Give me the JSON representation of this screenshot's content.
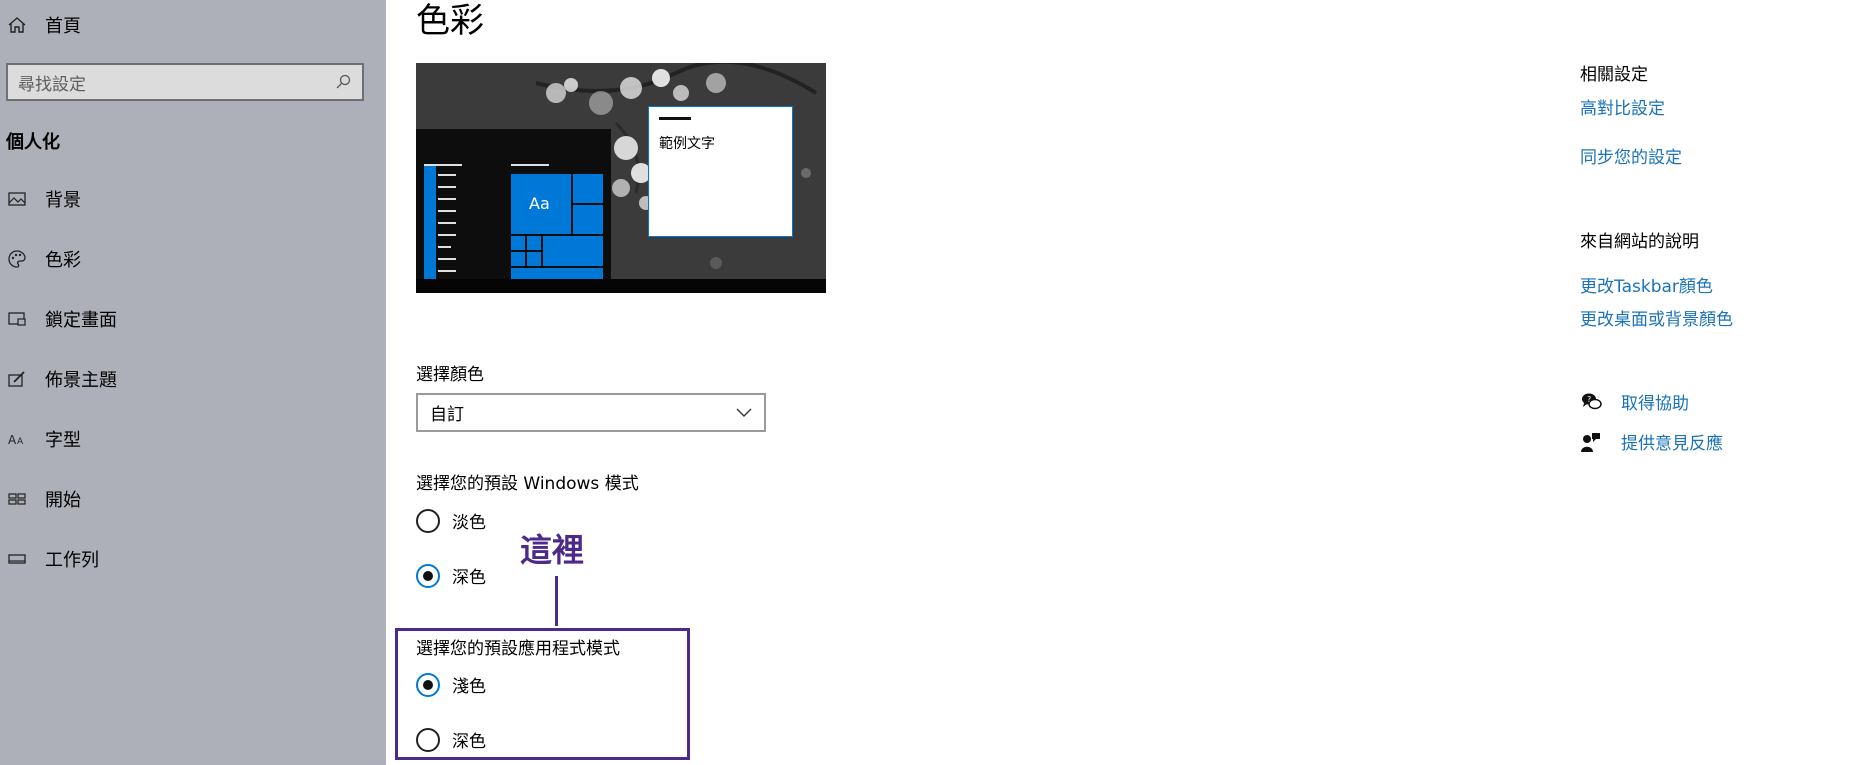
{
  "sidebar": {
    "home_label": "首頁",
    "search_placeholder": "尋找設定",
    "section_title": "個人化",
    "items": [
      {
        "label": "背景",
        "icon": "picture-icon"
      },
      {
        "label": "色彩",
        "icon": "palette-icon"
      },
      {
        "label": "鎖定畫面",
        "icon": "lock-screen-icon"
      },
      {
        "label": "佈景主題",
        "icon": "theme-brush-icon"
      },
      {
        "label": "字型",
        "icon": "font-icon"
      },
      {
        "label": "開始",
        "icon": "start-icon"
      },
      {
        "label": "工作列",
        "icon": "taskbar-icon"
      }
    ]
  },
  "main": {
    "title": "色彩",
    "preview": {
      "sample_text": "範例文字",
      "tile_label": "Aa"
    },
    "choose_color_label": "選擇顏色",
    "choose_color_value": "自訂",
    "windows_mode_label": "選擇您的預設 Windows 模式",
    "windows_mode_options": [
      {
        "label": "淡色",
        "checked": false
      },
      {
        "label": "深色",
        "checked": true
      }
    ],
    "app_mode_label": "選擇您的預設應用程式模式",
    "app_mode_options": [
      {
        "label": "淺色",
        "checked": true
      },
      {
        "label": "深色",
        "checked": false
      }
    ]
  },
  "annotation": {
    "text": "這裡",
    "color": "#4b2a8a"
  },
  "right": {
    "related_heading": "相關設定",
    "related_links": [
      "高對比設定",
      "同步您的設定"
    ],
    "web_help_heading": "來自網站的說明",
    "web_help_links": [
      "更改Taskbar顏色",
      "更改桌面或背景顏色"
    ],
    "get_help": "取得協助",
    "give_feedback": "提供意見反應",
    "link_color": "#1a73b8"
  },
  "colors": {
    "sidebar_bg": "#aeb0b9",
    "accent": "#0078d7"
  }
}
